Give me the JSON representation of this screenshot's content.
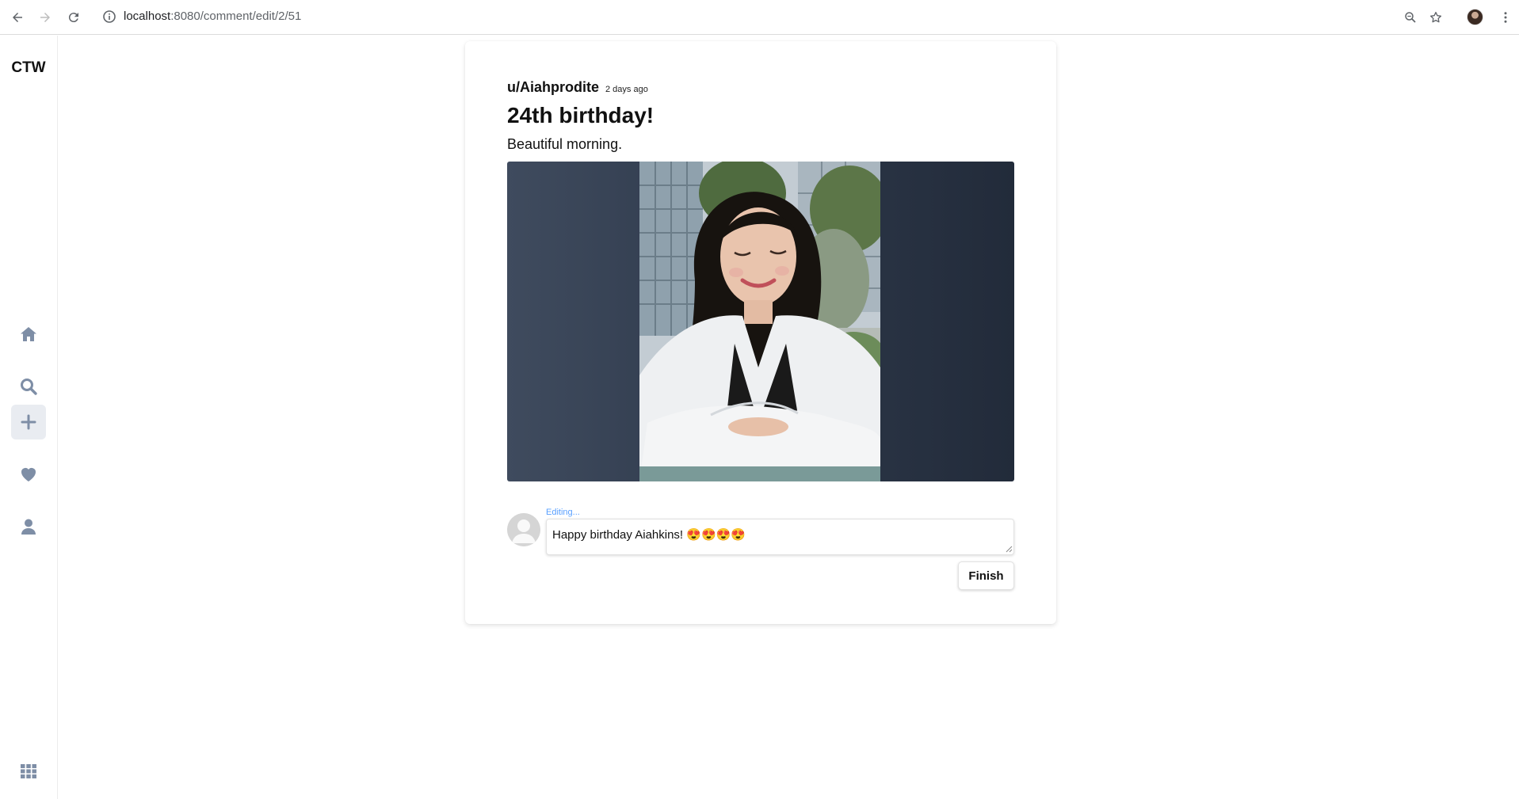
{
  "browser": {
    "url_host": "localhost",
    "url_path": ":8080/comment/edit/2/51"
  },
  "app": {
    "brand": "CTW",
    "nav": [
      {
        "name": "home",
        "icon": "home-icon"
      },
      {
        "name": "search",
        "icon": "search-icon"
      },
      {
        "name": "create",
        "icon": "plus-icon",
        "active": true
      },
      {
        "name": "likes",
        "icon": "heart-icon"
      },
      {
        "name": "profile",
        "icon": "user-icon"
      },
      {
        "name": "apps",
        "icon": "grid-icon"
      }
    ],
    "icon_color": "#7e8ea6"
  },
  "post": {
    "username": "u/Aiahprodite",
    "time": "2 days ago",
    "title": "24th birthday!",
    "body": "Beautiful morning."
  },
  "comment": {
    "status": "Editing...",
    "text": "Happy birthday Aiahkins! 😍😍😍😍",
    "submit_label": "Finish"
  }
}
